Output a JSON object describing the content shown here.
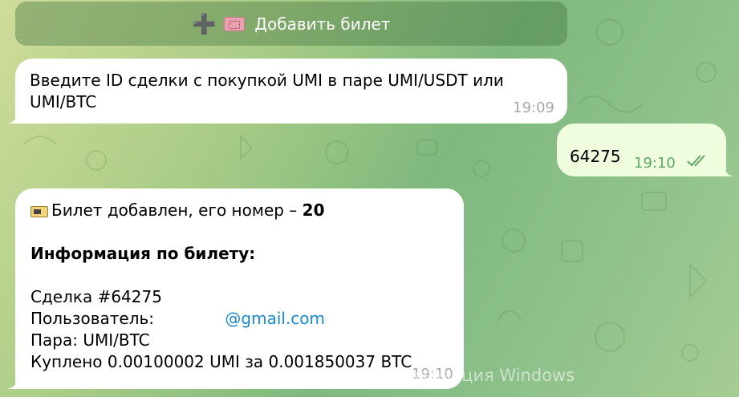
{
  "inline_button": {
    "plus": "➕",
    "label": "Добавить билет",
    "icon": "admit-one-ticket-icon"
  },
  "messages": [
    {
      "direction": "incoming",
      "text_line1": "Введите ID сделки с покупкой UMI в паре UMI/USDT или",
      "text_line2": "UMI/BTC",
      "time": "19:09"
    },
    {
      "direction": "outgoing",
      "text": "64275",
      "time": "19:10",
      "status_icon": "double-check-icon"
    },
    {
      "direction": "incoming",
      "icon": "ticket-icon",
      "added_prefix": "Билет добавлен, его номер – ",
      "ticket_number": "20",
      "info_heading": "Информация по билету:",
      "deal": "Сделка #64275",
      "user_label": "Пользователь: ",
      "user_email": "@gmail.com",
      "pair": "Пара: UMI/BTC",
      "bought": "Куплено 0.00100002 UMI за 0.001850037 BTC",
      "time": "19:10"
    }
  ],
  "watermark": "Активация Windows",
  "colors": {
    "incoming_bubble": "#ffffff",
    "outgoing_bubble": "#effdde",
    "link": "#168acd",
    "outgoing_time": "#5fa86a"
  }
}
